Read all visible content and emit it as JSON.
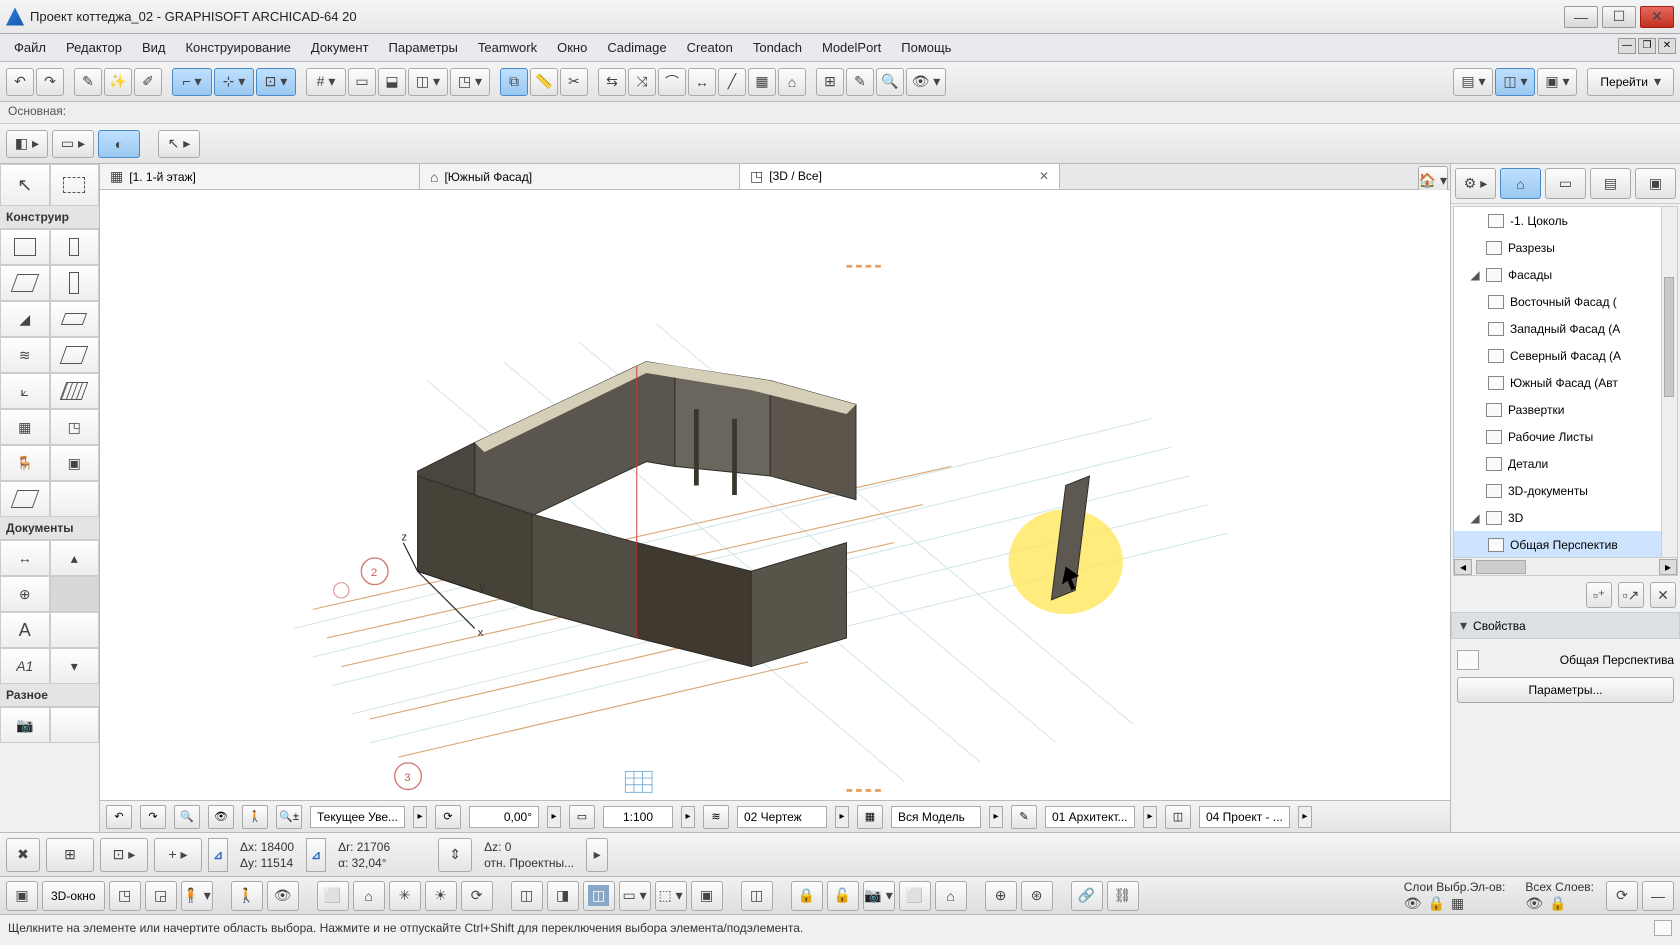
{
  "title": "Проект коттеджа_02 - GRAPHISOFT ARCHICAD-64 20",
  "menu": [
    "Файл",
    "Редактор",
    "Вид",
    "Конструирование",
    "Документ",
    "Параметры",
    "Teamwork",
    "Окно",
    "Cadimage",
    "Creaton",
    "Tondach",
    "ModelPort",
    "Помощь"
  ],
  "navButton": "Перейти",
  "quickLayer": "Основная:",
  "tabs": [
    {
      "label": "[1. 1-й этаж]",
      "active": false,
      "icon": "floor"
    },
    {
      "label": "[Южный Фасад]",
      "active": false,
      "icon": "elev"
    },
    {
      "label": "[3D / Все]",
      "active": true,
      "icon": "cube",
      "closable": true
    }
  ],
  "leftSections": {
    "build": "Конструир",
    "docs": "Документы",
    "misc": "Разное"
  },
  "navigator": {
    "items": [
      {
        "label": "-1. Цоколь",
        "indent": 2,
        "icon": "story"
      },
      {
        "label": "Разрезы",
        "indent": 1,
        "icon": "section"
      },
      {
        "label": "Фасады",
        "indent": 1,
        "icon": "elev",
        "expanded": true
      },
      {
        "label": "Восточный Фасад (",
        "indent": 2,
        "icon": "elev"
      },
      {
        "label": "Западный Фасад (А",
        "indent": 2,
        "icon": "elev"
      },
      {
        "label": "Северный Фасад (А",
        "indent": 2,
        "icon": "elev"
      },
      {
        "label": "Южный Фасад (Авт",
        "indent": 2,
        "icon": "elev"
      },
      {
        "label": "Развертки",
        "indent": 1,
        "icon": "ie"
      },
      {
        "label": "Рабочие Листы",
        "indent": 1,
        "icon": "ws"
      },
      {
        "label": "Детали",
        "indent": 1,
        "icon": "det"
      },
      {
        "label": "3D-документы",
        "indent": 1,
        "icon": "3dd"
      },
      {
        "label": "3D",
        "indent": 1,
        "icon": "3d",
        "expanded": true
      },
      {
        "label": "Общая Перспектив",
        "indent": 2,
        "icon": "3d",
        "selected": true
      }
    ]
  },
  "properties": {
    "header": "Свойства",
    "viewName": "Общая Перспектива",
    "paramsBtn": "Параметры..."
  },
  "bottombar": {
    "zoomMode": "Текущее Уве...",
    "angle": "0,00°",
    "scale": "1:100",
    "drawing": "02 Чертеж",
    "model": "Вся Модель",
    "arch": "01 Архитект...",
    "project": "04 Проект - ..."
  },
  "coords": {
    "dx": "Δx: 18400",
    "dy": "Δy: 11514",
    "dr": "Δr: 21706",
    "da": "α: 32,04°",
    "dz": "Δz: 0",
    "ref": "отн. Проектны..."
  },
  "toolbar3": {
    "modeLabel": "3D-окно"
  },
  "layers": {
    "selLabel": "Слои Выбр.Эл-ов:",
    "allLabel": "Всех Слоев:"
  },
  "statusText": "Щелкните на элементе или начертите область выбора. Нажмите и не отпускайте Ctrl+Shift для переключения выбора элемента/подэлемента."
}
